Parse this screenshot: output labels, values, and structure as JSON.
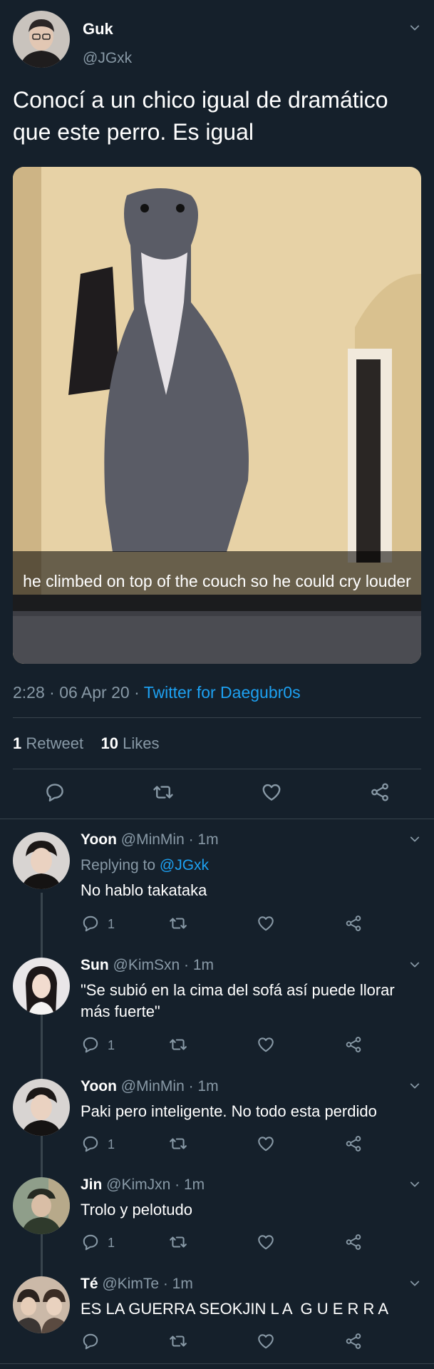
{
  "tweet": {
    "name": "Guk",
    "handle": "@JGxk",
    "text": "Conocí a un chico igual de dramático que este perro. Es igual",
    "media_caption": "he climbed on top of the couch so he could cry louder",
    "time": "2:28 · 06 Apr 20 · ",
    "source": "Twitter for Daegubr0s",
    "retweets_count": "1",
    "retweets_label": " Retweet",
    "likes_count": "10",
    "likes_label": " Likes"
  },
  "replies": [
    {
      "name": "Yoon",
      "meta": " @MinMin · 1m",
      "replying_prefix": "Replying to ",
      "replying_handle": "@JGxk",
      "text": "No hablo takataka",
      "reply_count": "1"
    },
    {
      "name": "Sun",
      "meta": " @KimSxn · 1m",
      "text": "\"Se subió en la cima del sofá así puede llorar más fuerte\"",
      "reply_count": "1"
    },
    {
      "name": "Yoon",
      "meta": " @MinMin · 1m",
      "text": "Paki pero inteligente. No todo esta perdido",
      "reply_count": "1"
    },
    {
      "name": "Jin",
      "meta": " @KimJxn · 1m",
      "text": "Trolo y pelotudo",
      "reply_count": "1"
    },
    {
      "name": "Té",
      "meta": " @KimTe · 1m",
      "text": "ES LA GUERRA SEOKJIN L A  G U E R R A",
      "reply_count": ""
    }
  ],
  "icons": {
    "chevron": "chevron-down-icon",
    "reply": "reply-icon",
    "retweet": "retweet-icon",
    "like": "heart-icon",
    "share": "share-icon"
  },
  "colors": {
    "background": "#15202b",
    "secondary_text": "#8899a6",
    "link": "#1da1f2",
    "divider": "#38444d"
  }
}
